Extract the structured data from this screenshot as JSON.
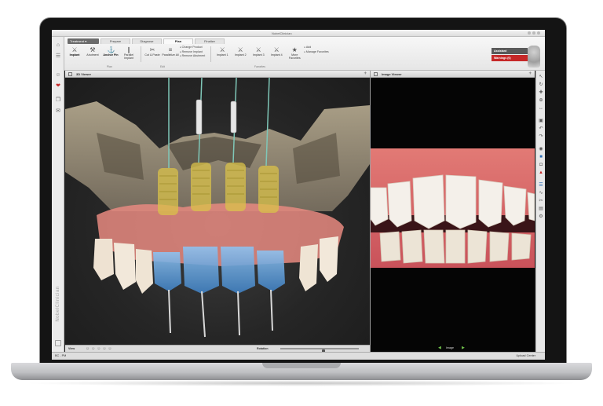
{
  "window": {
    "title": "NobelClinician"
  },
  "ribbon": {
    "treatment_dropdown": "Treatment",
    "tabs": [
      "Prepare",
      "Diagnose",
      "Plan",
      "Finalize"
    ],
    "active_tab": "Plan",
    "tools": [
      {
        "label": "Implant",
        "icon": "implant-icon",
        "active": true
      },
      {
        "label": "Abutment",
        "icon": "abutment-icon",
        "active": false
      },
      {
        "label": "Anchor Pin",
        "icon": "anchor-pin-icon",
        "active": true
      },
      {
        "label": "Parallel Implant",
        "icon": "parallel-implant-icon",
        "active": false
      },
      {
        "label": "Cut & Paste",
        "icon": "cut-paste-icon",
        "active": false
      },
      {
        "label": "Parallelize All",
        "icon": "parallelize-icon",
        "active": false
      }
    ],
    "product_actions": [
      "Change Product",
      "Remove Implant",
      "Remove Abutment"
    ],
    "favorites": [
      "Implant 1",
      "Implant 2",
      "Implant 3",
      "Implant 4",
      "More Favorites"
    ],
    "favorite_actions": [
      "Add",
      "Manage Favorites"
    ],
    "group_labels": {
      "plan": "Plan",
      "edit": "Edit",
      "favorites": "Favorites"
    },
    "status": {
      "assistant": "Assistant",
      "warnings": "Warnings (0)"
    }
  },
  "leftbar": {
    "brand": "NobelClinician"
  },
  "viewers": {
    "viewer_3d": {
      "title": "3D Viewer",
      "view_label": "View",
      "rotation_label": "Rotation",
      "rotation_value": 0.55
    },
    "image_viewer": {
      "title": "Image Viewer",
      "nav_label": "Image"
    }
  },
  "statusbar": {
    "left": "BC - PM",
    "right": "Upload Center"
  },
  "colors": {
    "accent_red": "#c62828",
    "implant_green": "#7fc7b8",
    "crown_blue": "#5b9fd9",
    "gum_pink": "#e88a80",
    "implant_yellow": "#d9c24a"
  }
}
